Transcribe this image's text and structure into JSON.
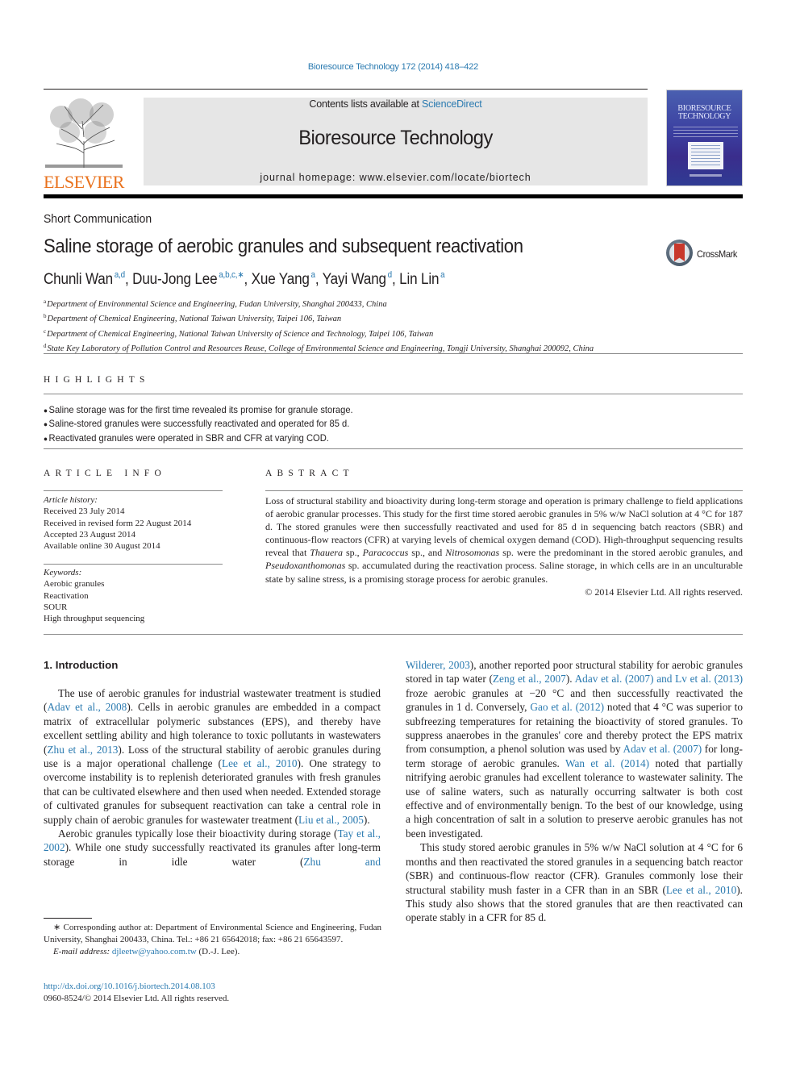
{
  "journal_ref": "Bioresource Technology 172 (2014) 418–422",
  "publisher": {
    "name": "ELSEVIER",
    "color": "#e9711c"
  },
  "masthead": {
    "contents_prefix": "Contents lists available at ",
    "contents_link": "ScienceDirect",
    "journal_title": "Bioresource Technology",
    "homepage": "journal homepage: www.elsevier.com/locate/biortech"
  },
  "cover": {
    "title_line1": "BIORESOURCE",
    "title_line2": "TECHNOLOGY"
  },
  "article_type": "Short Communication",
  "title": "Saline storage of aerobic granules and subsequent reactivation",
  "crossmark": "CrossMark",
  "authors": [
    {
      "name": "Chunli Wan",
      "affil": "a,d"
    },
    {
      "name": "Duu-Jong Lee",
      "affil": "a,b,c,∗"
    },
    {
      "name": "Xue Yang",
      "affil": "a"
    },
    {
      "name": "Yayi Wang",
      "affil": "d"
    },
    {
      "name": "Lin Lin",
      "affil": "a"
    }
  ],
  "affiliations": [
    {
      "key": "a",
      "text": "Department of Environmental Science and Engineering, Fudan University, Shanghai 200433, China"
    },
    {
      "key": "b",
      "text": "Department of Chemical Engineering, National Taiwan University, Taipei 106, Taiwan"
    },
    {
      "key": "c",
      "text": "Department of Chemical Engineering, National Taiwan University of Science and Technology, Taipei 106, Taiwan"
    },
    {
      "key": "d",
      "text": "State Key Laboratory of Pollution Control and Resources Reuse, College of Environmental Science and Engineering, Tongji University, Shanghai 200092, China"
    }
  ],
  "highlights": {
    "label": "HIGHLIGHTS",
    "items": [
      "Saline storage was for the first time revealed its promise for granule storage.",
      "Saline-stored granules were successfully reactivated and operated for 85 d.",
      "Reactivated granules were operated in SBR and CFR at varying COD."
    ]
  },
  "article_info": {
    "label": "ARTICLE INFO",
    "history_label": "Article history:",
    "history": [
      "Received 23 July 2014",
      "Received in revised form 22 August 2014",
      "Accepted 23 August 2014",
      "Available online 30 August 2014"
    ],
    "keywords_label": "Keywords:",
    "keywords": [
      "Aerobic granules",
      "Reactivation",
      "SOUR",
      "High throughput sequencing"
    ]
  },
  "abstract": {
    "label": "ABSTRACT",
    "s1": "Loss of structural stability and bioactivity during long-term storage and operation is primary challenge to field applications of aerobic granular processes. This study for the first time stored aerobic granules in 5% w/w NaCl solution at 4 °C for 187 d. The stored granules were then successfully reactivated and used for 85 d in sequencing batch reactors (SBR) and continuous-flow reactors (CFR) at varying levels of chemical oxygen demand (COD). High-throughput sequencing results reveal that ",
    "sp1": "Thauera",
    "s2": " sp., ",
    "sp2": "Paracoccus",
    "s3": " sp., and ",
    "sp3": "Nitrosomonas",
    "s4": " sp. were the predominant in the stored aerobic granules, and ",
    "sp4": "Pseudoxanthomonas",
    "s5": " sp. accumulated during the reactivation process. Saline storage, in which cells are in an unculturable state by saline stress, is a promising storage process for aerobic granules.",
    "copyright": "© 2014 Elsevier Ltd. All rights reserved."
  },
  "intro": {
    "heading": "1. Introduction",
    "p1": {
      "t1": "The use of aerobic granules for industrial wastewater treatment is studied (",
      "c1": "Adav et al., 2008",
      "t2": "). Cells in aerobic granules are embedded in a compact matrix of extracellular polymeric substances (EPS), and thereby have excellent settling ability and high tolerance to toxic pollutants in wastewaters (",
      "c2": "Zhu et al., 2013",
      "t3": "). Loss of the structural stability of aerobic granules during use is a major operational challenge (",
      "c3": "Lee et al., 2010",
      "t4": "). One strategy to overcome instability is to replenish deteriorated granules with fresh granules that can be cultivated elsewhere and then used when needed. Extended storage of cultivated granules for subsequent reactivation can take a central role in supply chain of aerobic granules for wastewater treatment (",
      "c4": "Liu et al., 2005",
      "t5": ")."
    },
    "p2": {
      "t1": "Aerobic granules typically lose their bioactivity during storage (",
      "c1": "Tay et al., 2002",
      "t2": "). While one study successfully reactivated its granules after long-term storage in idle water (",
      "c2a": "Zhu and",
      "c2b": "Wilderer, 2003",
      "t3": "), another reported poor structural stability for aerobic granules stored in tap water (",
      "c3": "Zeng et al., 2007",
      "t4": "). ",
      "c4": "Adav et al. (2007) and Lv et al. (2013)",
      "t5": " froze aerobic granules at −20 °C and then successfully reactivated the granules in 1 d. Conversely, ",
      "c5": "Gao et al. (2012)",
      "t6": " noted that 4 °C was superior to subfreezing temperatures for retaining the bioactivity of stored granules. To suppress anaerobes in the granules' core and thereby protect the EPS matrix from consumption, a phenol solution was used by ",
      "c6": "Adav et al. (2007)",
      "t7": " for long-term storage of aerobic granules. ",
      "c7": "Wan et al. (2014)",
      "t8": " noted that partially nitrifying aerobic granules had excellent tolerance to wastewater salinity. The use of saline waters, such as naturally occurring saltwater is both cost effective and of environmentally benign. To the best of our knowledge, using a high concentration of salt in a solution to preserve aerobic granules has not been investigated."
    },
    "p3": {
      "t1": "This study stored aerobic granules in 5% w/w NaCl solution at 4 °C for 6 months and then reactivated the stored granules in a sequencing batch reactor (SBR) and continuous-flow reactor (CFR). Granules commonly lose their structural stability mush faster in a CFR than in an SBR (",
      "c1": "Lee et al., 2010",
      "t2": "). This study also shows that the stored granules that are then reactivated can operate stably in a CFR for 85 d."
    }
  },
  "footnote": {
    "corresponding": "∗ Corresponding author at: Department of Environmental Science and Engineering, Fudan University, Shanghai 200433, China. Tel.: +86 21 65642018; fax: +86 21 65643597.",
    "email_label": "E-mail address:",
    "email": "djleetw@yahoo.com.tw",
    "email_suffix": " (D.-J. Lee)."
  },
  "doi": "http://dx.doi.org/10.1016/j.biortech.2014.08.103",
  "issn_line": "0960-8524/© 2014 Elsevier Ltd. All rights reserved."
}
